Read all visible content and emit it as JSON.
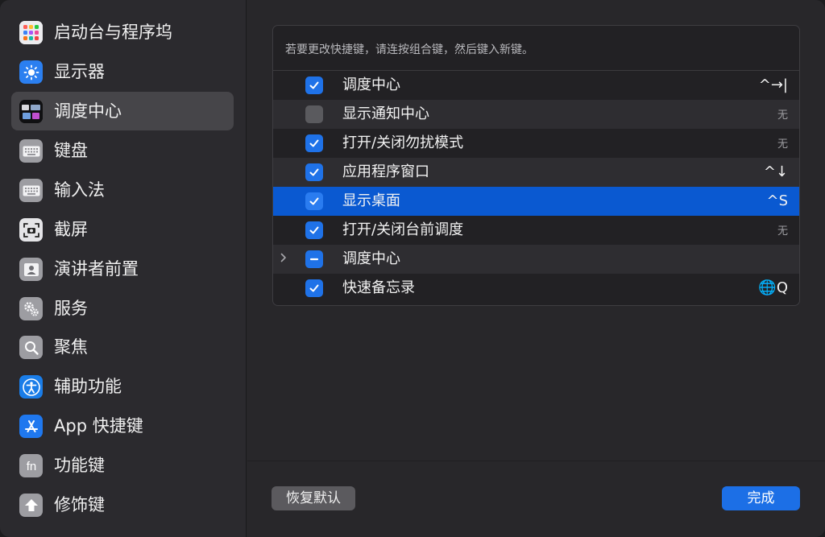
{
  "sidebar": {
    "items": [
      {
        "label": "启动台与程序坞",
        "icon": "launchpad-icon"
      },
      {
        "label": "显示器",
        "icon": "display-brightness-icon"
      },
      {
        "label": "调度中心",
        "icon": "mission-control-icon",
        "selected": true
      },
      {
        "label": "键盘",
        "icon": "keyboard-icon"
      },
      {
        "label": "输入法",
        "icon": "input-method-keyboard-icon"
      },
      {
        "label": "截屏",
        "icon": "screenshot-camera-icon"
      },
      {
        "label": "演讲者前置",
        "icon": "presenter-overlay-icon"
      },
      {
        "label": "服务",
        "icon": "services-gears-icon"
      },
      {
        "label": "聚焦",
        "icon": "spotlight-search-icon"
      },
      {
        "label": "辅助功能",
        "icon": "accessibility-icon"
      },
      {
        "label": "App 快捷键",
        "icon": "app-store-icon"
      },
      {
        "label": "功能键",
        "icon": "fn-key-icon"
      },
      {
        "label": "修饰键",
        "icon": "modifier-key-up-arrow-icon"
      }
    ]
  },
  "main": {
    "hint": "若要更改快捷键，请连按组合键，然后键入新键。",
    "rows": [
      {
        "label": "调度中心",
        "checked": "checked",
        "shortcut": "^→|"
      },
      {
        "label": "显示通知中心",
        "checked": "unchecked",
        "shortcut": "无"
      },
      {
        "label": "打开/关闭勿扰模式",
        "checked": "checked",
        "shortcut": "无"
      },
      {
        "label": "应用程序窗口",
        "checked": "checked",
        "shortcut": "^↓"
      },
      {
        "label": "显示桌面",
        "checked": "checked",
        "shortcut": "^S",
        "selected": true
      },
      {
        "label": "打开/关闭台前调度",
        "checked": "checked",
        "shortcut": "无"
      },
      {
        "label": "调度中心",
        "checked": "mixed",
        "shortcut": "",
        "expandable": true
      },
      {
        "label": "快速备忘录",
        "checked": "checked",
        "shortcut": "🌐Q"
      }
    ],
    "reset_label": "恢复默认",
    "done_label": "完成"
  },
  "colors": {
    "accent": "#1f72e8",
    "selection": "#0a59d1",
    "sidebar_selected": "#464549"
  }
}
